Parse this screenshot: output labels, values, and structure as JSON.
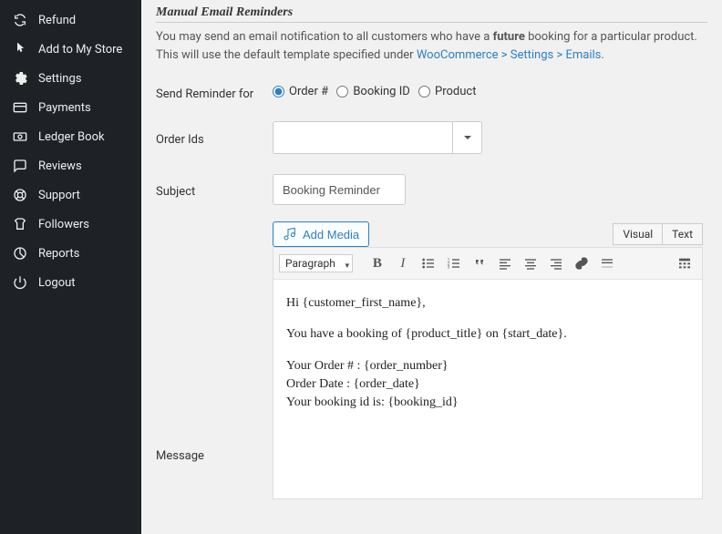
{
  "sidebar": {
    "items": [
      {
        "label": "Refund"
      },
      {
        "label": "Add to My Store"
      },
      {
        "label": "Settings"
      },
      {
        "label": "Payments"
      },
      {
        "label": "Ledger Book"
      },
      {
        "label": "Reviews"
      },
      {
        "label": "Support"
      },
      {
        "label": "Followers"
      },
      {
        "label": "Reports"
      },
      {
        "label": "Logout"
      }
    ]
  },
  "section": {
    "title": "Manual Email Reminders",
    "desc_pre": "You may send an email notification to all customers who have a ",
    "desc_bold": "future",
    "desc_post": " booking for a particular product. This will use the default template specified under ",
    "link": "WooCommerce > Settings > Emails",
    "dot": "."
  },
  "form": {
    "send_label": "Send Reminder for",
    "order_ids_label": "Order Ids",
    "subject_label": "Subject",
    "message_label": "Message",
    "radio_order": "Order #",
    "radio_booking": "Booking ID",
    "radio_product": "Product",
    "subject_value": "Booking Reminder",
    "add_media": "Add Media"
  },
  "editor": {
    "tab_visual": "Visual",
    "tab_text": "Text",
    "paragraph": "Paragraph",
    "body_p1": "Hi {customer_first_name},",
    "body_p2": "You have a booking of {product_title} on {start_date}.",
    "body_l1": "Your Order # : {order_number}",
    "body_l2": "Order Date : {order_date}",
    "body_l3": "Your booking id is: {booking_id}"
  }
}
